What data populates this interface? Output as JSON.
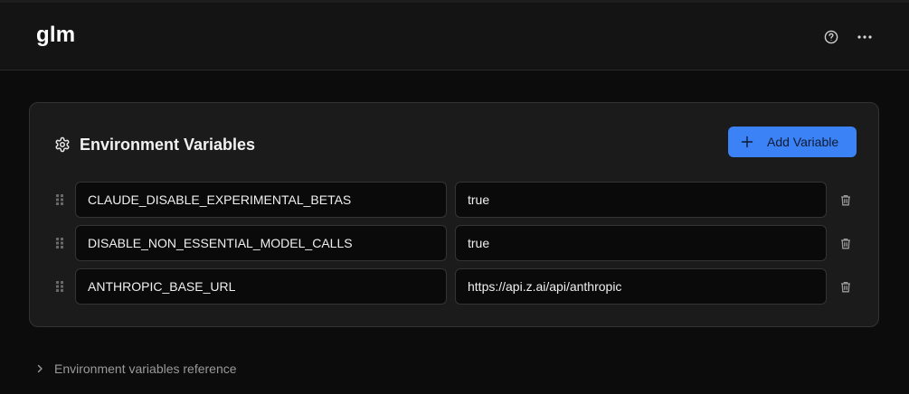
{
  "header": {
    "title": "glm",
    "icons": [
      "help-circle-icon",
      "more-horizontal-icon"
    ]
  },
  "env_card": {
    "title": "Environment Variables",
    "title_icon": "gear-icon",
    "add_button_label": "Add Variable",
    "variables": [
      {
        "key": "CLAUDE_DISABLE_EXPERIMENTAL_BETAS",
        "value": "true"
      },
      {
        "key": "DISABLE_NON_ESSENTIAL_MODEL_CALLS",
        "value": "true"
      },
      {
        "key": "ANTHROPIC_BASE_URL",
        "value": "https://api.z.ai/api/anthropic"
      }
    ]
  },
  "reference": {
    "label": "Environment variables reference"
  },
  "colors": {
    "accent": "#3b82f6",
    "background": "#0c0c0c",
    "card": "#1b1b1b"
  }
}
